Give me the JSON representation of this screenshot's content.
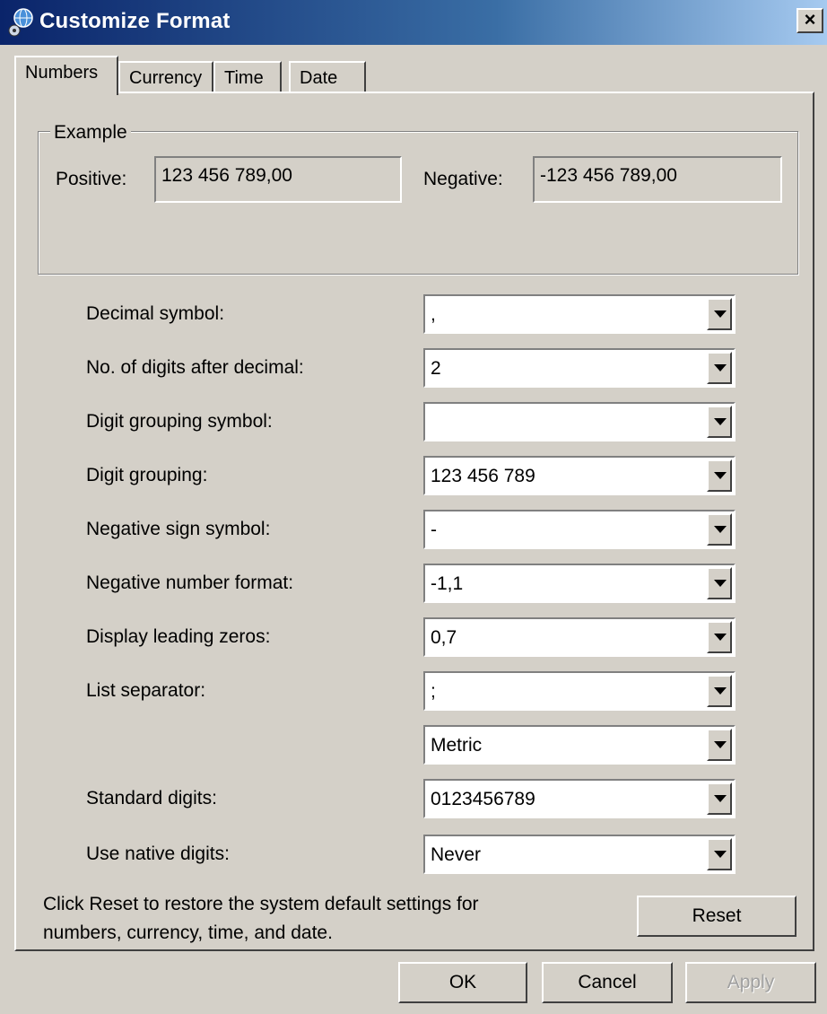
{
  "window": {
    "title": "Customize Format"
  },
  "tabs": [
    {
      "label": "Numbers"
    },
    {
      "label": "Currency"
    },
    {
      "label": "Time"
    },
    {
      "label": "Date"
    }
  ],
  "example": {
    "legend": "Example",
    "positive_label": "Positive:",
    "positive_value": "123 456 789,00",
    "negative_label": "Negative:",
    "negative_value": "-123 456 789,00"
  },
  "settings": [
    {
      "label": "Decimal symbol:",
      "value": ","
    },
    {
      "label": "No. of digits after decimal:",
      "value": "2"
    },
    {
      "label": "Digit grouping symbol:",
      "value": ""
    },
    {
      "label": "Digit grouping:",
      "value": "123 456 789"
    },
    {
      "label": "Negative sign symbol:",
      "value": "-"
    },
    {
      "label": "Negative number format:",
      "value": "-1,1"
    },
    {
      "label": "Display leading zeros:",
      "value": "0,7"
    },
    {
      "label": "List separator:",
      "value": ";"
    },
    {
      "label": "",
      "value": "Metric"
    },
    {
      "label": "Standard digits:",
      "value": "0123456789"
    },
    {
      "label": "Use native digits:",
      "value": "Never"
    }
  ],
  "reset": {
    "info_line1": "Click Reset to restore the system default settings for",
    "info_line2": "numbers, currency, time, and date.",
    "button": "Reset"
  },
  "footer": {
    "ok": "OK",
    "cancel": "Cancel",
    "apply": "Apply"
  },
  "colors": {
    "titlebar_start": "#0a246a",
    "dialog_bg": "#d4d0c8"
  }
}
